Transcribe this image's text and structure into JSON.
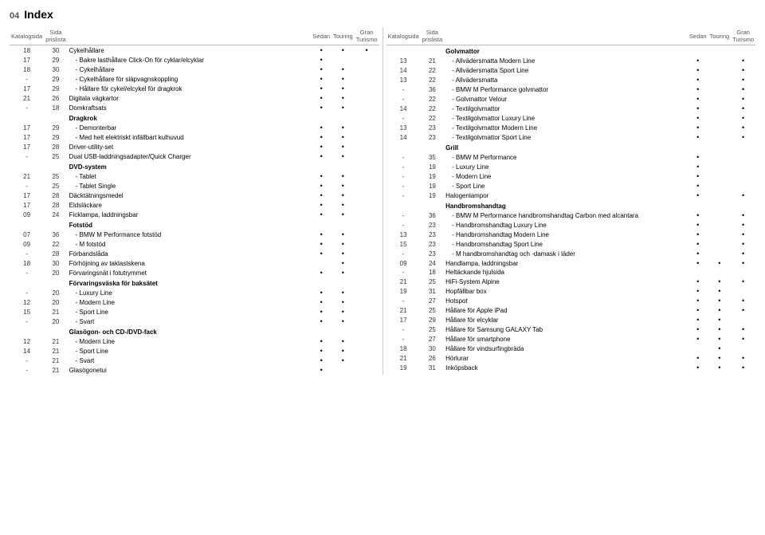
{
  "header": {
    "page_number": "04",
    "title": "Index"
  },
  "left_column": {
    "headers": {
      "katalog": "Katalog­sida",
      "sida": "Sida\nprislista",
      "sedan": "Sedan",
      "touring": "Touring",
      "gran": "Gran\nTurismo"
    },
    "rows": [
      {
        "k": "18",
        "s": "30",
        "label": "Cykelhållare",
        "indent": false,
        "section": false,
        "sedan": true,
        "touring": true,
        "gran": true
      },
      {
        "k": "17",
        "s": "29",
        "label": "- Bakre lasthållare Click-On för cyklar/elcyklar",
        "indent": true,
        "section": false,
        "sedan": true,
        "touring": false,
        "gran": false
      },
      {
        "k": "18",
        "s": "30",
        "label": "- Cykelhållare",
        "indent": true,
        "section": false,
        "sedan": true,
        "touring": true,
        "gran": false
      },
      {
        "k": "-",
        "s": "29",
        "label": "- Cykelhållare för släpvagnskoppling",
        "indent": true,
        "section": false,
        "sedan": true,
        "touring": true,
        "gran": false
      },
      {
        "k": "17",
        "s": "29",
        "label": "- Hållare för cykel/elcykel för dragkrok",
        "indent": true,
        "section": false,
        "sedan": true,
        "touring": true,
        "gran": false
      },
      {
        "k": "21",
        "s": "26",
        "label": "Digitala vägkartor",
        "indent": false,
        "section": false,
        "sedan": true,
        "touring": true,
        "gran": false
      },
      {
        "k": "-",
        "s": "18",
        "label": "Domkraftsats",
        "indent": false,
        "section": false,
        "sedan": true,
        "touring": true,
        "gran": false
      },
      {
        "k": "",
        "s": "",
        "label": "Dragkrok",
        "indent": false,
        "section": true,
        "sedan": false,
        "touring": false,
        "gran": false
      },
      {
        "k": "17",
        "s": "29",
        "label": "- Demonterbar",
        "indent": true,
        "section": false,
        "sedan": true,
        "touring": true,
        "gran": false
      },
      {
        "k": "17",
        "s": "29",
        "label": "- Med helt elektriskt infällbart kulhuvud",
        "indent": true,
        "section": false,
        "sedan": true,
        "touring": true,
        "gran": false
      },
      {
        "k": "17",
        "s": "28",
        "label": "Driver-utility-set",
        "indent": false,
        "section": false,
        "sedan": true,
        "touring": true,
        "gran": false
      },
      {
        "k": "-",
        "s": "25",
        "label": "Dual USB-laddningsadapter/Quick Charger",
        "indent": false,
        "section": false,
        "sedan": true,
        "touring": true,
        "gran": false
      },
      {
        "k": "",
        "s": "",
        "label": "DVD-system",
        "indent": false,
        "section": true,
        "sedan": false,
        "touring": false,
        "gran": false
      },
      {
        "k": "21",
        "s": "25",
        "label": "- Tablet",
        "indent": true,
        "section": false,
        "sedan": true,
        "touring": true,
        "gran": false
      },
      {
        "k": "-",
        "s": "25",
        "label": "- Tablet Single",
        "indent": true,
        "section": false,
        "sedan": true,
        "touring": true,
        "gran": false
      },
      {
        "k": "17",
        "s": "28",
        "label": "Däcktätningsmedel",
        "indent": false,
        "section": false,
        "sedan": true,
        "touring": true,
        "gran": false
      },
      {
        "k": "17",
        "s": "28",
        "label": "Eldsläckare",
        "indent": false,
        "section": false,
        "sedan": true,
        "touring": true,
        "gran": false
      },
      {
        "k": "09",
        "s": "24",
        "label": "Ficklampa, laddningsbar",
        "indent": false,
        "section": false,
        "sedan": true,
        "touring": true,
        "gran": false
      },
      {
        "k": "",
        "s": "",
        "label": "Fotstöd",
        "indent": false,
        "section": true,
        "sedan": false,
        "touring": false,
        "gran": false
      },
      {
        "k": "07",
        "s": "36",
        "label": "- BMW M Performance fotstöd",
        "indent": true,
        "section": false,
        "sedan": true,
        "touring": true,
        "gran": false
      },
      {
        "k": "09",
        "s": "22",
        "label": "- M fotstöd",
        "indent": true,
        "section": false,
        "sedan": true,
        "touring": true,
        "gran": false
      },
      {
        "k": "-",
        "s": "28",
        "label": "Förbandslåda",
        "indent": false,
        "section": false,
        "sedan": true,
        "touring": true,
        "gran": false
      },
      {
        "k": "18",
        "s": "30",
        "label": "Förhöjning av taklastskena",
        "indent": false,
        "section": false,
        "sedan": false,
        "touring": true,
        "gran": false
      },
      {
        "k": "-",
        "s": "20",
        "label": "Förvaringsnät i fotutrymmet",
        "indent": false,
        "section": false,
        "sedan": true,
        "touring": true,
        "gran": false
      },
      {
        "k": "",
        "s": "",
        "label": "Förvaringsväska för baksätet",
        "indent": false,
        "section": true,
        "sedan": false,
        "touring": false,
        "gran": false
      },
      {
        "k": "-",
        "s": "20",
        "label": "- Luxury Line",
        "indent": true,
        "section": false,
        "sedan": true,
        "touring": true,
        "gran": false
      },
      {
        "k": "12",
        "s": "20",
        "label": "- Modern Line",
        "indent": true,
        "section": false,
        "sedan": true,
        "touring": true,
        "gran": false
      },
      {
        "k": "15",
        "s": "21",
        "label": "- Sport Line",
        "indent": true,
        "section": false,
        "sedan": true,
        "touring": true,
        "gran": false
      },
      {
        "k": "-",
        "s": "20",
        "label": "- Svart",
        "indent": true,
        "section": false,
        "sedan": true,
        "touring": true,
        "gran": false
      },
      {
        "k": "",
        "s": "",
        "label": "Glasögon- och CD-/DVD-fack",
        "indent": false,
        "section": true,
        "sedan": false,
        "touring": false,
        "gran": false
      },
      {
        "k": "12",
        "s": "21",
        "label": "- Modern Line",
        "indent": true,
        "section": false,
        "sedan": true,
        "touring": true,
        "gran": false
      },
      {
        "k": "14",
        "s": "21",
        "label": "- Sport Line",
        "indent": true,
        "section": false,
        "sedan": true,
        "touring": true,
        "gran": false
      },
      {
        "k": "-",
        "s": "21",
        "label": "- Svart",
        "indent": true,
        "section": false,
        "sedan": true,
        "touring": true,
        "gran": false
      },
      {
        "k": "-",
        "s": "21",
        "label": "Glasögonetui",
        "indent": false,
        "section": false,
        "sedan": true,
        "touring": false,
        "gran": false
      }
    ]
  },
  "right_column": {
    "headers": {
      "katalog": "Katalog­sida",
      "sida": "Sida\nprislista",
      "sedan": "Sedan",
      "touring": "Touring",
      "gran": "Gran\nTurismo"
    },
    "rows": [
      {
        "k": "",
        "s": "",
        "label": "Golvmattor",
        "indent": false,
        "section": true,
        "sedan": false,
        "touring": false,
        "gran": false
      },
      {
        "k": "13",
        "s": "21",
        "label": "- Allvädersmatta Modern Line",
        "indent": true,
        "section": false,
        "sedan": true,
        "touring": false,
        "gran": true
      },
      {
        "k": "14",
        "s": "22",
        "label": "- Allvädersmatta Sport Line",
        "indent": true,
        "section": false,
        "sedan": true,
        "touring": false,
        "gran": true
      },
      {
        "k": "13",
        "s": "22",
        "label": "- Allvädersmatta",
        "indent": true,
        "section": false,
        "sedan": true,
        "touring": false,
        "gran": true
      },
      {
        "k": "-",
        "s": "36",
        "label": "- BMW M Performance golvmattor",
        "indent": true,
        "section": false,
        "sedan": true,
        "touring": false,
        "gran": true
      },
      {
        "k": "-",
        "s": "22",
        "label": "- Golvmattor Velour",
        "indent": true,
        "section": false,
        "sedan": true,
        "touring": false,
        "gran": true
      },
      {
        "k": "14",
        "s": "22",
        "label": "- Textilgolvmattor",
        "indent": true,
        "section": false,
        "sedan": true,
        "touring": false,
        "gran": true
      },
      {
        "k": "-",
        "s": "22",
        "label": "- Textilgolvmattor Luxury Line",
        "indent": true,
        "section": false,
        "sedan": true,
        "touring": false,
        "gran": true
      },
      {
        "k": "13",
        "s": "23",
        "label": "- Textilgolvmattor Modern Line",
        "indent": true,
        "section": false,
        "sedan": true,
        "touring": false,
        "gran": true
      },
      {
        "k": "14",
        "s": "23",
        "label": "- Textilgolvmattor Sport Line",
        "indent": true,
        "section": false,
        "sedan": true,
        "touring": false,
        "gran": true
      },
      {
        "k": "",
        "s": "",
        "label": "Grill",
        "indent": false,
        "section": true,
        "sedan": false,
        "touring": false,
        "gran": false
      },
      {
        "k": "-",
        "s": "35",
        "label": "- BMW M Performance",
        "indent": true,
        "section": false,
        "sedan": true,
        "touring": false,
        "gran": false
      },
      {
        "k": "-",
        "s": "19",
        "label": "- Luxury Line",
        "indent": true,
        "section": false,
        "sedan": true,
        "touring": false,
        "gran": false
      },
      {
        "k": "-",
        "s": "19",
        "label": "- Modern Line",
        "indent": true,
        "section": false,
        "sedan": true,
        "touring": false,
        "gran": false
      },
      {
        "k": "-",
        "s": "19",
        "label": "- Sport Line",
        "indent": true,
        "section": false,
        "sedan": true,
        "touring": false,
        "gran": false
      },
      {
        "k": "-",
        "s": "19",
        "label": "Halogenlampor",
        "indent": false,
        "section": false,
        "sedan": true,
        "touring": false,
        "gran": true
      },
      {
        "k": "",
        "s": "",
        "label": "Handbromshandtag",
        "indent": false,
        "section": true,
        "sedan": false,
        "touring": false,
        "gran": false
      },
      {
        "k": "-",
        "s": "36",
        "label": "- BMW M Performance handbromshandtag Carbon med alcantara",
        "indent": true,
        "section": false,
        "sedan": true,
        "touring": false,
        "gran": true
      },
      {
        "k": "-",
        "s": "23",
        "label": "- Handbromshandtag Luxury Line",
        "indent": true,
        "section": false,
        "sedan": true,
        "touring": false,
        "gran": true
      },
      {
        "k": "13",
        "s": "23",
        "label": "- Handbromshandtag Modern Line",
        "indent": true,
        "section": false,
        "sedan": true,
        "touring": false,
        "gran": true
      },
      {
        "k": "15",
        "s": "23",
        "label": "- Handbromshandtag Sport Line",
        "indent": true,
        "section": false,
        "sedan": true,
        "touring": false,
        "gran": true
      },
      {
        "k": "-",
        "s": "23",
        "label": "- M handbromshandtag och -damask i läder",
        "indent": true,
        "section": false,
        "sedan": true,
        "touring": false,
        "gran": true
      },
      {
        "k": "09",
        "s": "24",
        "label": "Handlampa, laddningsbar",
        "indent": false,
        "section": false,
        "sedan": true,
        "touring": true,
        "gran": true
      },
      {
        "k": "-",
        "s": "18",
        "label": "Heltäckande hjulsida",
        "indent": false,
        "section": false,
        "sedan": false,
        "touring": false,
        "gran": false
      },
      {
        "k": "21",
        "s": "25",
        "label": "HiFi-System Alpine",
        "indent": false,
        "section": false,
        "sedan": true,
        "touring": true,
        "gran": true
      },
      {
        "k": "19",
        "s": "31",
        "label": "Hopfällbar box",
        "indent": false,
        "section": false,
        "sedan": true,
        "touring": true,
        "gran": false
      },
      {
        "k": "-",
        "s": "27",
        "label": "Hotspot",
        "indent": false,
        "section": false,
        "sedan": true,
        "touring": true,
        "gran": true
      },
      {
        "k": "21",
        "s": "25",
        "label": "Hållare för Apple iPad",
        "indent": false,
        "section": false,
        "sedan": true,
        "touring": true,
        "gran": true
      },
      {
        "k": "17",
        "s": "29",
        "label": "Hållare för elcyklar",
        "indent": false,
        "section": false,
        "sedan": true,
        "touring": true,
        "gran": false
      },
      {
        "k": "-",
        "s": "25",
        "label": "Hållare för Samsung GALAXY Tab",
        "indent": false,
        "section": false,
        "sedan": true,
        "touring": true,
        "gran": true
      },
      {
        "k": "-",
        "s": "27",
        "label": "Hållare för smartphone",
        "indent": false,
        "section": false,
        "sedan": true,
        "touring": true,
        "gran": true
      },
      {
        "k": "18",
        "s": "30",
        "label": "Hållare för vindsurfingbräda",
        "indent": false,
        "section": false,
        "sedan": false,
        "touring": true,
        "gran": false
      },
      {
        "k": "21",
        "s": "26",
        "label": "Hörlurar",
        "indent": false,
        "section": false,
        "sedan": true,
        "touring": true,
        "gran": true
      },
      {
        "k": "19",
        "s": "31",
        "label": "Inköpsback",
        "indent": false,
        "section": false,
        "sedan": true,
        "touring": true,
        "gran": true
      }
    ]
  }
}
